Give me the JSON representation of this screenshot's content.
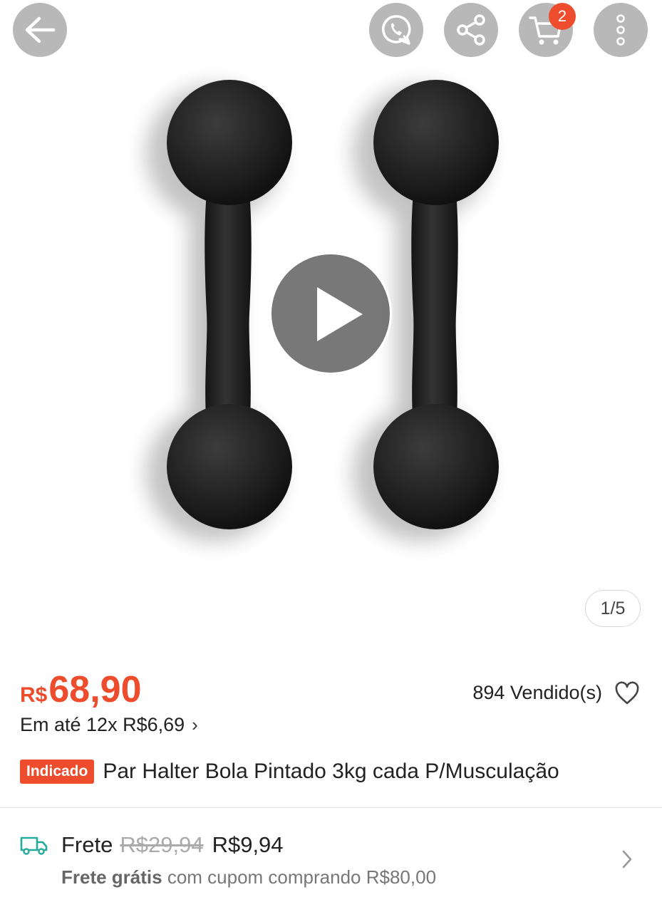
{
  "header": {
    "icons": [
      "back-arrow-icon",
      "whatsapp-icon",
      "share-icon",
      "cart-icon",
      "more-icon"
    ],
    "cart_count": "2"
  },
  "gallery": {
    "page_indicator": "1/5",
    "play_icon": "play-icon"
  },
  "product": {
    "currency": "R$",
    "price": "68,90",
    "sold": "894 Vendido(s)",
    "installments": "Em até 12x R$6,69",
    "installments_chevron": "›",
    "tag": "Indicado",
    "title": "Par Halter Bola Pintado 3kg cada P/Musculação"
  },
  "shipping": {
    "label": "Frete",
    "old_price": "R$29,94",
    "new_price": "R$9,94",
    "promo_bold": "Frete grátis",
    "promo_rest": " com cupom comprando R$80,00"
  },
  "colors": {
    "accent": "#ee4d2d",
    "icon_bg": "#b8b8b8",
    "truck": "#26aa99"
  }
}
